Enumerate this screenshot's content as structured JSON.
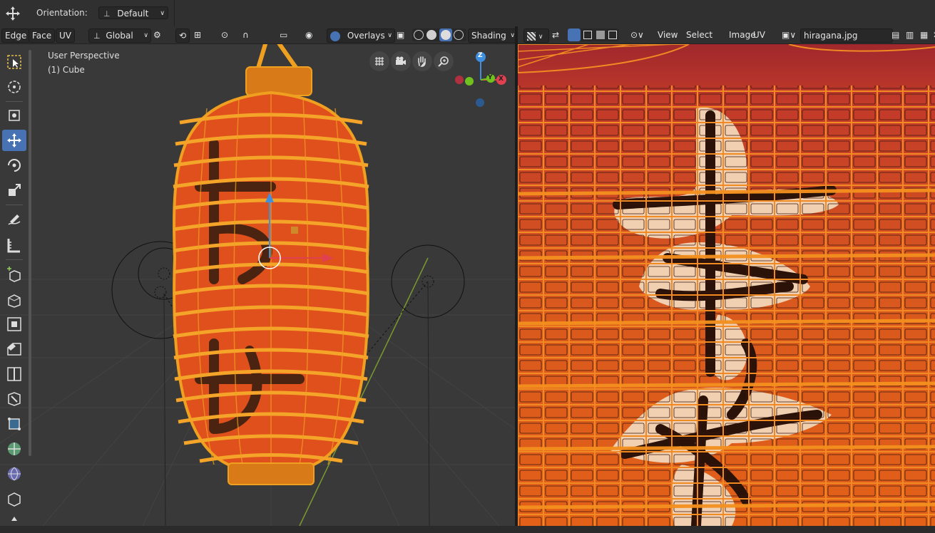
{
  "topbar": {
    "orientation_label": "Orientation:",
    "orientation_value": "Default"
  },
  "viewport_header": {
    "menus": [
      "Edge",
      "Face",
      "UV"
    ],
    "transform_orientation": "Global",
    "overlays_label": "Overlays",
    "shading_label": "Shading"
  },
  "viewport": {
    "perspective_label": "User Perspective",
    "object_label": "(1) Cube",
    "gizmo_axes": {
      "z": "Z",
      "y": "Y",
      "x": "X"
    }
  },
  "uv_header": {
    "menus": [
      "View",
      "Select",
      "Image",
      "UV"
    ],
    "image_name": "hiragana.jpg"
  },
  "colors": {
    "accent": "#4772b3",
    "lantern_orange": "#f0a020",
    "lantern_red": "#e0501c",
    "axis_x": "#e04050",
    "axis_y": "#70c020",
    "axis_z": "#3e8fe0"
  }
}
